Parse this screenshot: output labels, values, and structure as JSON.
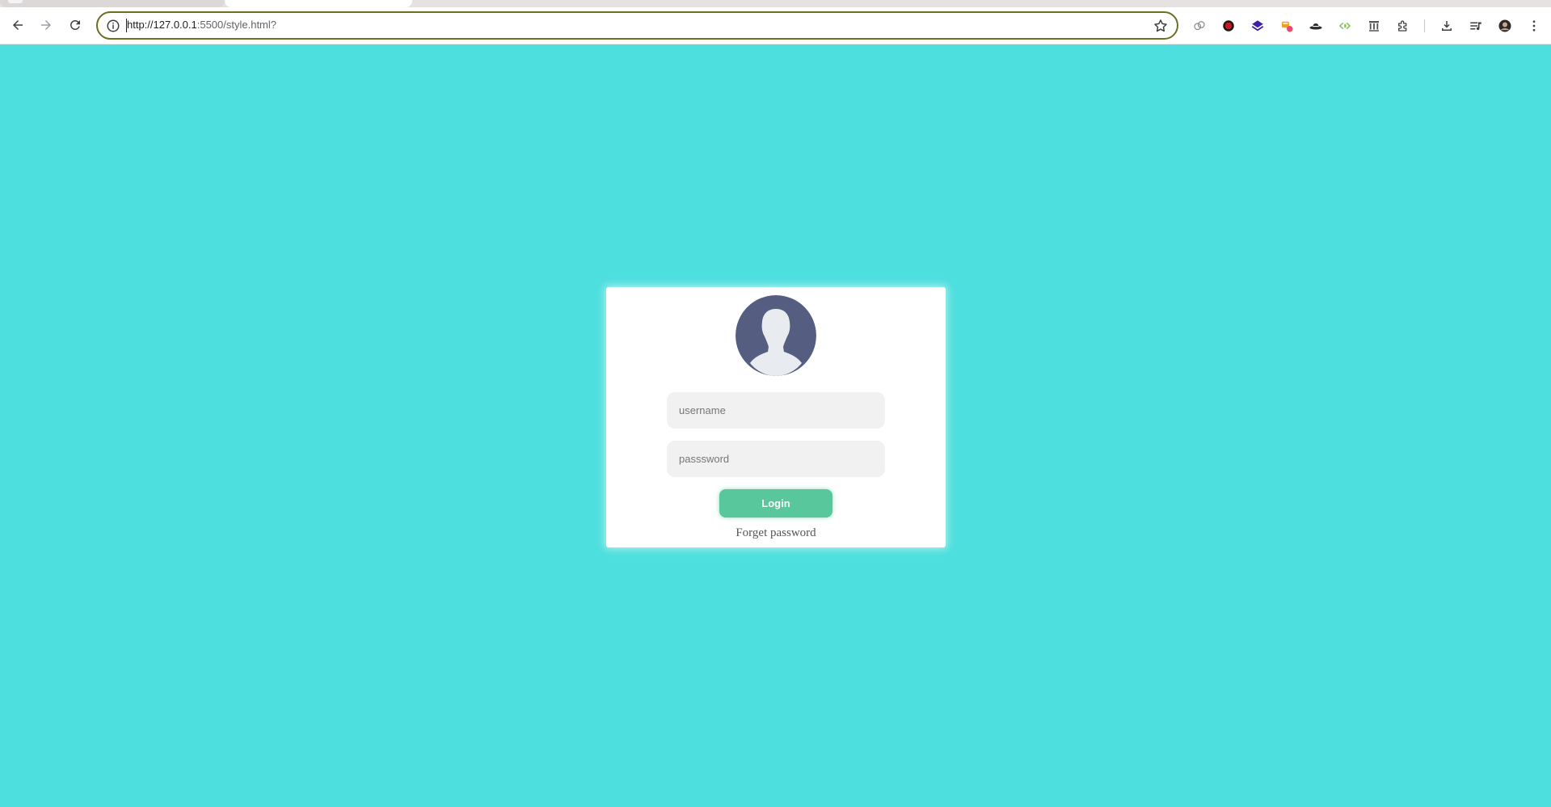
{
  "browser": {
    "url_host": "http://127.0.0.1",
    "url_rest": ":5500/style.html?",
    "accent_color": "#6b6f1f"
  },
  "page": {
    "background_color": "#4ddfde",
    "login_form": {
      "avatar": "user-avatar-icon",
      "username_placeholder": "username",
      "password_placeholder": "passsword",
      "login_label": "Login",
      "login_color": "#58c79b",
      "forget_label": "Forget password"
    }
  }
}
